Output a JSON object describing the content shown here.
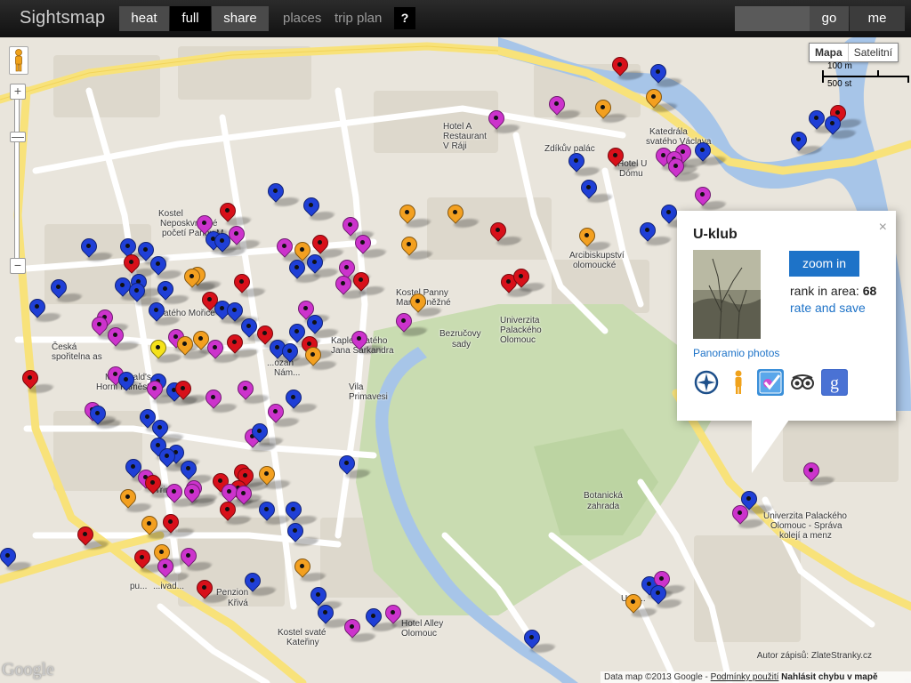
{
  "app": {
    "logo": "Sightsmap"
  },
  "toolbar": {
    "heat": "heat",
    "full": "full",
    "share": "share",
    "places": "places",
    "trip_plan": "trip plan",
    "help": "?",
    "search_value": "",
    "go": "go",
    "me": "me"
  },
  "map_controls": {
    "zoom_in": "+",
    "zoom_out": "−",
    "map_type_map": "Mapa",
    "map_type_satellite": "Satelitní",
    "scale_metric": "100 m",
    "scale_imperial": "500 st"
  },
  "map_labels": {
    "hotel_a": "Hotel A",
    "restaurant": "Restaurant",
    "v_raji": "V Ráji",
    "zdikuv_palac": "Zdíkův palác",
    "katedrala_1": "Katedrála",
    "katedrala_2": "svatého Václava",
    "hotel_u_1": "Hotel U",
    "hotel_u_2": "Dómu",
    "kostel_nep_1": "Kostel",
    "kostel_nep_2": "Neposkvrněné",
    "kostel_nep_3": "početí Panny M...",
    "arc_1": "Arcibiskupství",
    "arc_2": "olomoucké",
    "kostel_panny_1": "Kostel Panny",
    "kostel_panny_2": "Marie Sněžné",
    "univ_1": "Univerzita",
    "univ_2": "Palackého",
    "univ_3": "Olomouc",
    "mnoho": "svatého Mořice",
    "bezruc_1": "Bezručovy",
    "bezruc_2": "sady",
    "kaple_1": "Kaple svatého",
    "kaple_2": "Jana Sarkandra",
    "ceska_1": "Česká",
    "ceska_2": "spořitelna as",
    "mcd_1": "McDonald's",
    "mcd_2": "Horní náměstí",
    "vila_1": "Vila",
    "vila_2": "Primavesi",
    "botanicka_1": "Botanická",
    "botanicka_2": "zahrada",
    "upol_1": "Univerzita Palackého",
    "upol_2": "Olomouc - Správa",
    "upol_3": "kolejí a menz",
    "penzion_1": "Penzion",
    "penzion_2": "Křivá",
    "kostel_kat_1": "Kostel svaté",
    "kostel_kat_2": "Kateřiny",
    "hotel_alley_1": "Hotel Alley",
    "hotel_alley_2": "Olomouc",
    "trinity": "Trin...",
    "puppet": "pu...",
    "divadlo": "...ivad...",
    "univ_low": "Univ...",
    "ozan": "...ozan",
    "nam": "Nám..."
  },
  "info_window": {
    "title": "U-klub",
    "close": "×",
    "zoom_in": "zoom in",
    "rank_label": "rank in area:",
    "rank_value": "68",
    "rate": "rate and save",
    "panoramio": "Panoramio photos"
  },
  "attribution": {
    "google": "Google",
    "author": "Autor zápisů: ZlateStranky.cz",
    "data": "Data map ©2013 Google -",
    "terms": "Podmínky použití",
    "report": "Nahlásit chybu v mapě"
  },
  "colors": {
    "blue": "#1f3fd6",
    "red": "#d8101a",
    "magenta": "#cc33cc",
    "orange": "#f3a020",
    "yellow": "#f5e21a",
    "road_major": "#f8e27a",
    "road_minor": "#ffffff",
    "park": "#c9dcb1",
    "water": "#a7c5e8",
    "link": "#1e73c8"
  }
}
